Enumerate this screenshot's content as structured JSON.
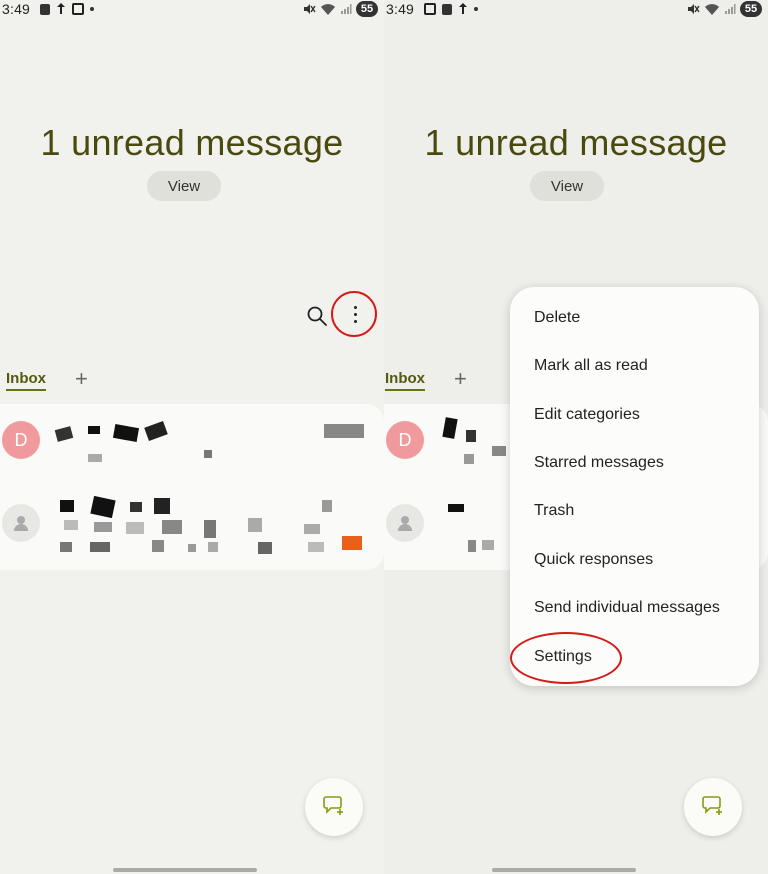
{
  "left": {
    "status": {
      "time": "3:49",
      "battery": "55"
    },
    "header": {
      "title": "1 unread message",
      "view_label": "View"
    },
    "tabs": {
      "inbox": "Inbox",
      "add": "+"
    },
    "messages": [
      {
        "avatar_letter": "D",
        "sender": "redacted"
      },
      {
        "avatar_letter": "",
        "sender": "redacted"
      }
    ]
  },
  "right": {
    "status": {
      "time": "3:49",
      "battery": "55"
    },
    "header": {
      "title": "1 unread message",
      "view_label": "View"
    },
    "tabs": {
      "inbox": "Inbox",
      "add": "+"
    },
    "messages": [
      {
        "avatar_letter": "D"
      },
      {
        "avatar_letter": ""
      }
    ],
    "menu": {
      "items": [
        "Delete",
        "Mark all as read",
        "Edit categories",
        "Starred messages",
        "Trash",
        "Quick responses",
        "Send individual messages",
        "Settings"
      ]
    }
  },
  "colors": {
    "accent": "#6b6f18",
    "title": "#4a4a10",
    "highlight": "#d61a1a",
    "avatar_d": "#f19a9e"
  }
}
